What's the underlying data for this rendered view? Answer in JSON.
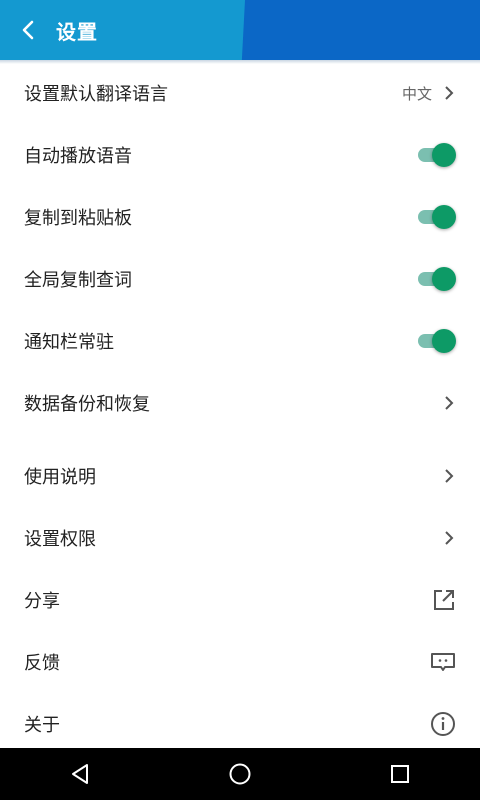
{
  "header": {
    "back_icon": "chevron-left-icon",
    "title": "设置",
    "colors": {
      "left": "#1499d0",
      "right": "#0b67c6"
    }
  },
  "settings": {
    "items": [
      {
        "label": "设置默认翻译语言",
        "value": "中文",
        "control": "chevron"
      },
      {
        "label": "自动播放语音",
        "control": "toggle",
        "on": true
      },
      {
        "label": "复制到粘贴板",
        "control": "toggle",
        "on": true
      },
      {
        "label": "全局复制查词",
        "control": "toggle",
        "on": true
      },
      {
        "label": "通知栏常驻",
        "control": "toggle",
        "on": true
      },
      {
        "label": "数据备份和恢复",
        "control": "chevron"
      },
      {
        "label": "使用说明",
        "control": "chevron"
      },
      {
        "label": "设置权限",
        "control": "chevron"
      },
      {
        "label": "分享",
        "control": "share-icon"
      },
      {
        "label": "反馈",
        "control": "feedback-icon"
      },
      {
        "label": "关于",
        "control": "info-icon"
      }
    ],
    "toggle_color": "#0d9a66"
  },
  "navbar": {
    "buttons": [
      "back-triangle-icon",
      "home-circle-icon",
      "recents-square-icon"
    ]
  }
}
